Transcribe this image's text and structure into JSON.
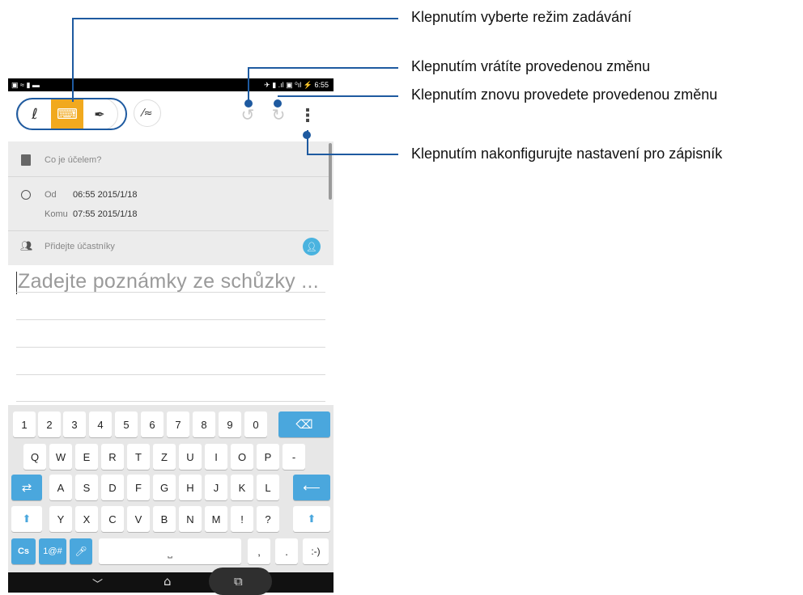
{
  "status_bar": {
    "left_icons": "▣ ≈ ▮ ▬",
    "right_text": "✈ ▮ .ıl ▣ ⁰ıl ⚡ 6:55"
  },
  "toolbar": {
    "modes": [
      {
        "icon": "handwriting-icon",
        "glyph": "ℓ",
        "selected": false
      },
      {
        "icon": "keyboard-icon",
        "glyph": "⌨",
        "selected": true
      },
      {
        "icon": "pen-icon",
        "glyph": "✒",
        "selected": false
      }
    ],
    "draw_icon": "⁄≈",
    "undo_glyph": "↺",
    "redo_glyph": "↻",
    "more_glyph": "⋮",
    "accent": "#f1a91e"
  },
  "form": {
    "purpose_placeholder": "Co je účelem?",
    "from_label": "Od",
    "from_value": "06:55 2015/1/18",
    "to_label": "Komu",
    "to_value": "07:55 2015/1/18",
    "participants_placeholder": "Přidejte účastníky"
  },
  "notes": {
    "placeholder": "Zadejte poznámky ze schůzky ..."
  },
  "keyboard": {
    "row1": [
      "1",
      "2",
      "3",
      "4",
      "5",
      "6",
      "7",
      "8",
      "9",
      "0"
    ],
    "row2": [
      "Q",
      "W",
      "E",
      "R",
      "T",
      "Z",
      "U",
      "I",
      "O",
      "P",
      "-"
    ],
    "row3": [
      "A",
      "S",
      "D",
      "F",
      "G",
      "H",
      "J",
      "K",
      "L"
    ],
    "row4": [
      "Y",
      "X",
      "C",
      "V",
      "B",
      "N",
      "M",
      "!",
      "?"
    ],
    "backspace": "⌫",
    "tab": "⇄",
    "enter": "⟵",
    "shift": "⬆",
    "lang": "Cs",
    "symbols": "1@#",
    "mic": "🎤︎",
    "space": "⎵",
    "comma": ",",
    "period": ".",
    "smiley": ":-)"
  },
  "nav": {
    "back": "﹀",
    "home": "⌂",
    "recent": "⧉"
  },
  "callouts": [
    "Klepnutím vyberte režim zadávání",
    "Klepnutím vrátíte provedenou změnu",
    "Klepnutím znovu provedete provedenou změnu",
    "Klepnutím nakonfigurujte nastavení pro zápisník"
  ],
  "colors": {
    "callout_line": "#1e5aa0",
    "keyboard_accent": "#4aa7dd",
    "badge": "#4ab3df"
  }
}
